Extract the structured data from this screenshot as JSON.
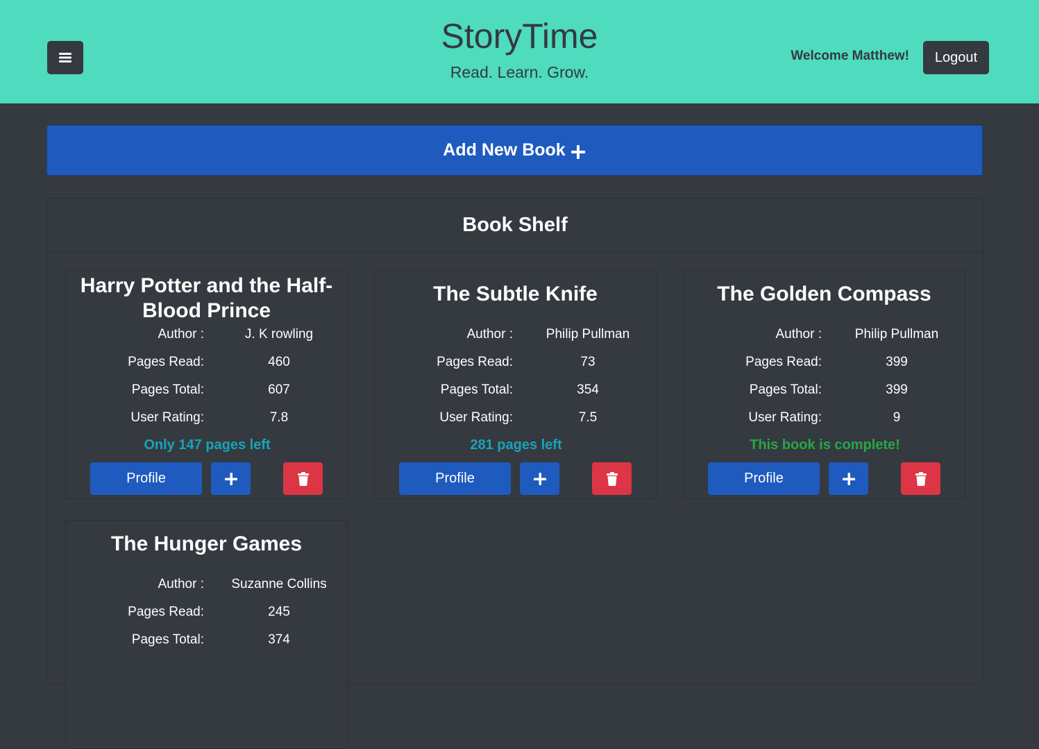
{
  "header": {
    "title": "StoryTime",
    "tagline": "Read. Learn. Grow.",
    "welcome": "Welcome Matthew!",
    "logout_label": "Logout",
    "menu_icon": "hamburger-icon"
  },
  "add_book": {
    "label": "Add New Book",
    "icon": "plus-icon"
  },
  "shelf": {
    "title": "Book Shelf"
  },
  "labels": {
    "author": "Author :",
    "pages_read": "Pages Read:",
    "pages_total": "Pages Total:",
    "user_rating": "User Rating:",
    "profile": "Profile"
  },
  "books": [
    {
      "title": "Harry Potter and the Half-Blood Prince",
      "author": "J. K rowling",
      "pages_read": "460",
      "pages_total": "607",
      "user_rating": "7.8",
      "status": "Only 147 pages left"
    },
    {
      "title": "The Subtle Knife",
      "author": "Philip Pullman",
      "pages_read": "73",
      "pages_total": "354",
      "user_rating": "7.5",
      "status": "281 pages left"
    },
    {
      "title": "The Golden Compass",
      "author": "Philip Pullman",
      "pages_read": "399",
      "pages_total": "399",
      "user_rating": "9",
      "status": "This book is complete!"
    },
    {
      "title": "The Hunger Games",
      "author": "Suzanne Collins",
      "pages_read": "245",
      "pages_total": "374"
    }
  ],
  "colors": {
    "header_bg": "#4fdbbd",
    "page_bg": "#343a40",
    "primary": "#1f5bbf",
    "danger": "#dc3545",
    "info": "#1aa3b8",
    "success": "#28a745"
  }
}
